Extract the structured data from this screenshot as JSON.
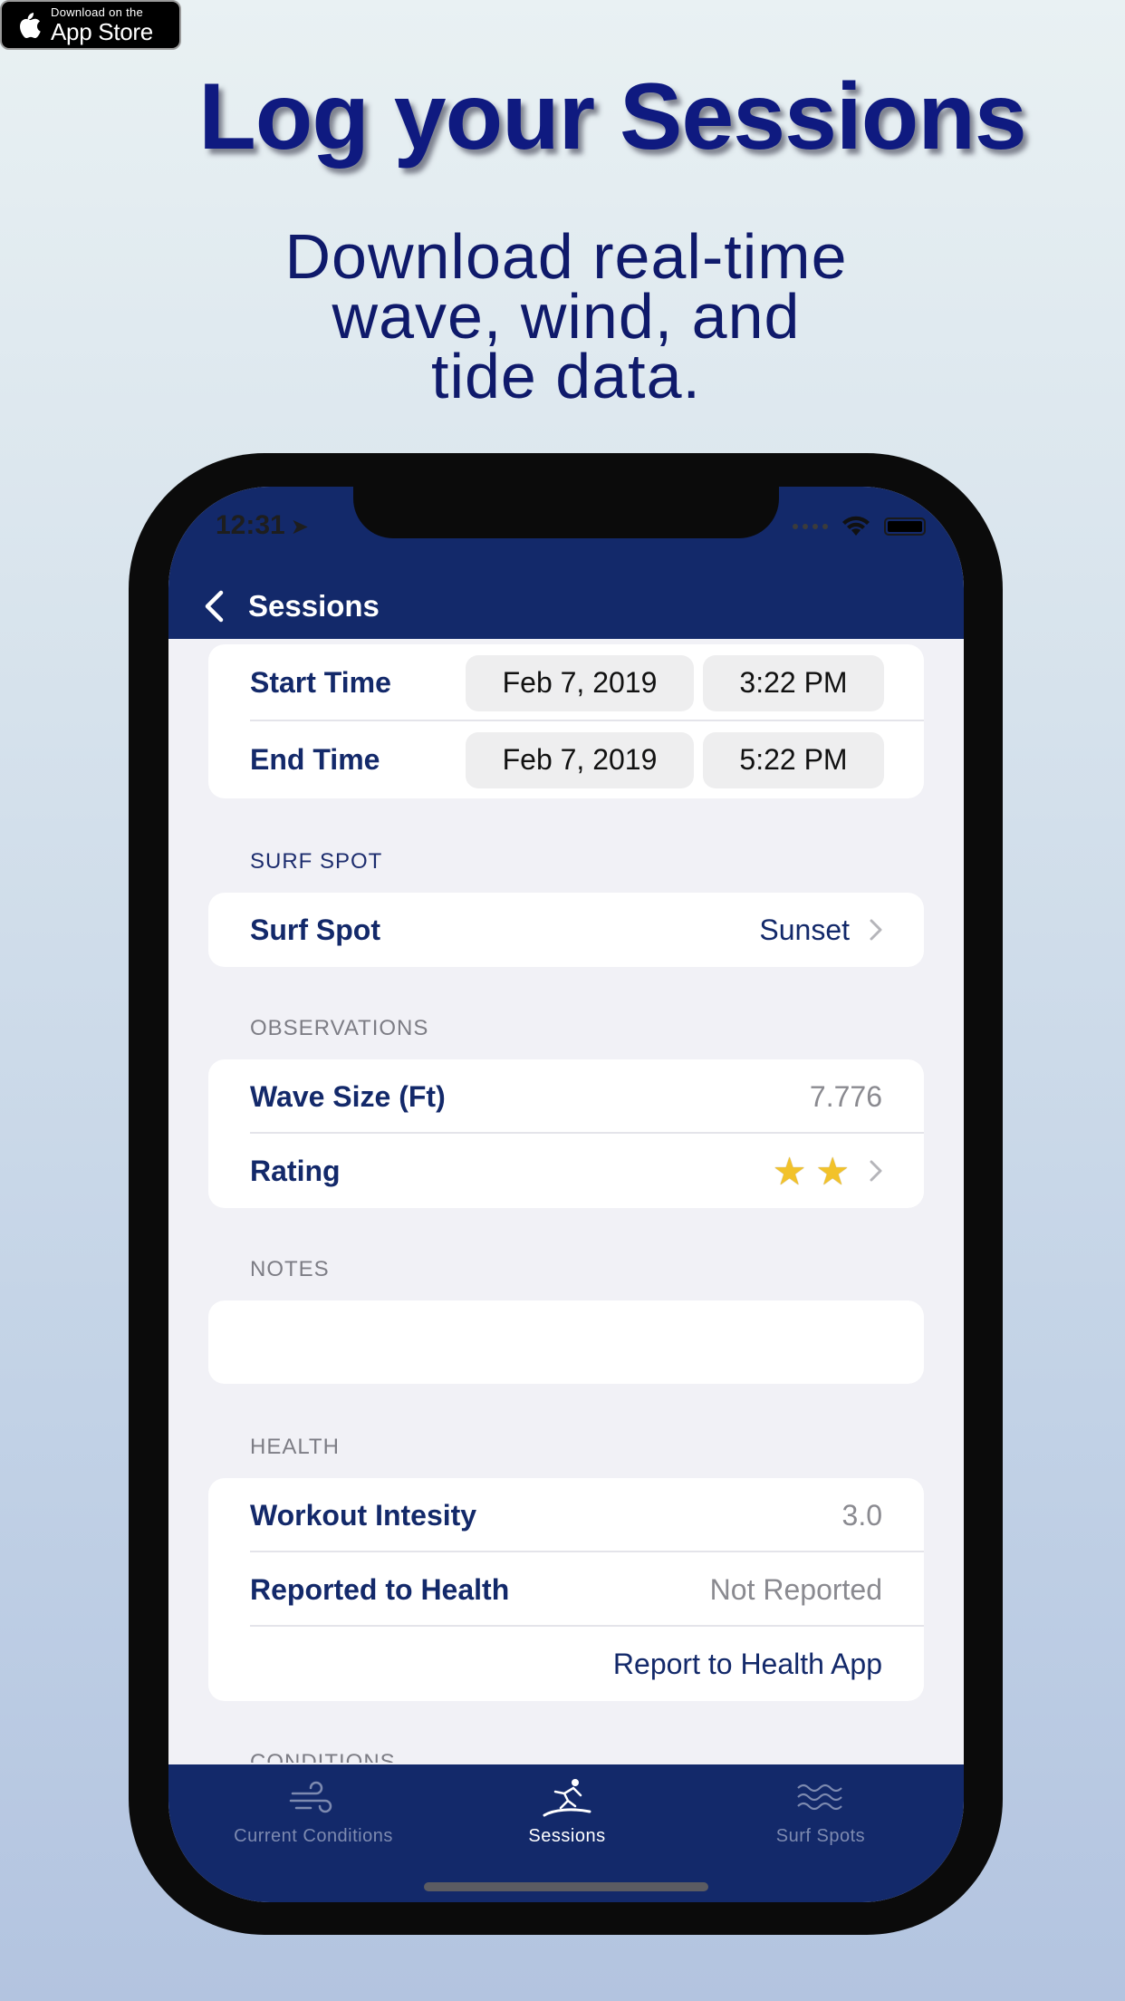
{
  "badge": {
    "small": "Download on the",
    "big": "App Store"
  },
  "headline": "Log your Sessions",
  "subhead": [
    "Download real-time",
    "wave, wind, and",
    "tide data."
  ],
  "status": {
    "time": "12:31"
  },
  "nav": {
    "title": "Sessions"
  },
  "times": {
    "start_label": "Start Time",
    "start_date": "Feb 7, 2019",
    "start_time": "3:22 PM",
    "end_label": "End Time",
    "end_date": "Feb 7, 2019",
    "end_time": "5:22 PM"
  },
  "surf_spot": {
    "header": "SURF SPOT",
    "label": "Surf Spot",
    "value": "Sunset"
  },
  "observations": {
    "header": "OBSERVATIONS",
    "wave_label": "Wave Size (Ft)",
    "wave_value": "7.776",
    "rating_label": "Rating",
    "rating_stars": 2
  },
  "notes": {
    "header": "NOTES"
  },
  "health": {
    "header": "HEALTH",
    "intensity_label": "Workout Intesity",
    "intensity_value": "3.0",
    "reported_label": "Reported to Health",
    "reported_value": "Not Reported",
    "report_action": "Report to Health App"
  },
  "conditions": {
    "header": "CONDITIONS"
  },
  "tabs": [
    {
      "label": "Current Conditions",
      "icon": "wind-icon",
      "active": false
    },
    {
      "label": "Sessions",
      "icon": "surfer-icon",
      "active": true
    },
    {
      "label": "Surf Spots",
      "icon": "waves-icon",
      "active": false
    }
  ],
  "colors": {
    "brand": "#13296a",
    "headline": "#0f1a80",
    "star": "#f2c22a"
  }
}
